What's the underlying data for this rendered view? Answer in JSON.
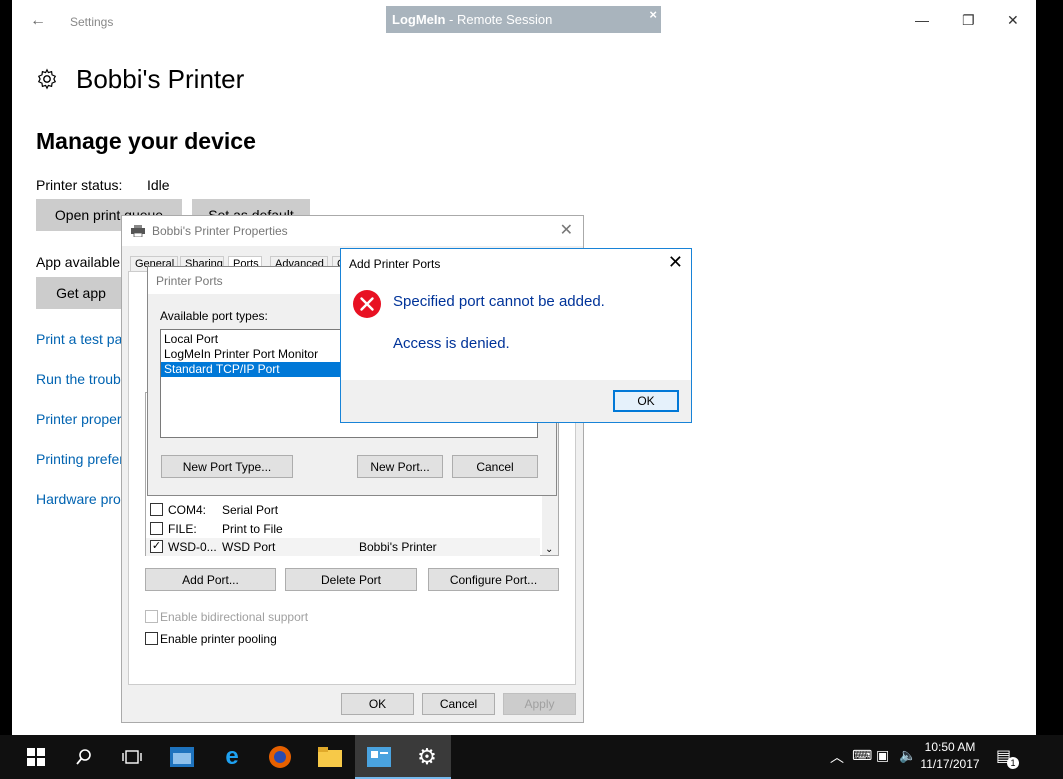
{
  "settings": {
    "header_label": "Settings",
    "page_title": "Bobbi's Printer",
    "section_title": "Manage your device",
    "status_label": "Printer status:",
    "status_value": "Idle",
    "open_queue_button": "Open print queue",
    "set_default_button": "Set as default",
    "app_available_label": "App available",
    "get_app_button": "Get app",
    "links": [
      "Print a test page",
      "Run the troubleshooter",
      "Printer properties",
      "Printing preferences",
      "Hardware properties"
    ]
  },
  "logmein": {
    "brand": "LogMeIn",
    "separator": " - ",
    "session": "Remote Session",
    "close": "×"
  },
  "properties_dialog": {
    "title": "Bobbi's Printer Properties",
    "tabs": [
      "General",
      "Sharing",
      "Ports",
      "Advanced",
      "Color Management"
    ],
    "ports": [
      {
        "port": "COM4:",
        "description": "Serial Port",
        "printer": "",
        "checked": false
      },
      {
        "port": "FILE:",
        "description": "Print to File",
        "printer": "",
        "checked": false
      },
      {
        "port": "WSD-0...",
        "description": "WSD Port",
        "printer": "Bobbi's Printer",
        "checked": true
      }
    ],
    "add_port_button": "Add Port...",
    "delete_port_button": "Delete Port",
    "configure_port_button": "Configure Port...",
    "bidirectional_label": "Enable bidirectional support",
    "pooling_label": "Enable printer pooling",
    "ok_button": "OK",
    "cancel_button": "Cancel",
    "apply_button": "Apply"
  },
  "printer_ports_dialog": {
    "title": "Printer Ports",
    "available_label": "Available port types:",
    "port_types": [
      "Local Port",
      "LogMeIn Printer Port Monitor",
      "Standard TCP/IP Port"
    ],
    "selected_index": 2,
    "new_port_type_button": "New Port Type...",
    "new_port_button": "New Port...",
    "cancel_button": "Cancel"
  },
  "error_dialog": {
    "title": "Add Printer Ports",
    "message": "Specified port cannot be added.",
    "detail": "Access is denied.",
    "ok_button": "OK"
  },
  "taskbar": {
    "time": "10:50 AM",
    "date": "11/17/2017",
    "notification_count": "1"
  },
  "colors": {
    "link": "#0063b1",
    "accent": "#0078d7",
    "error_red": "#e81123",
    "error_text": "#003399"
  }
}
